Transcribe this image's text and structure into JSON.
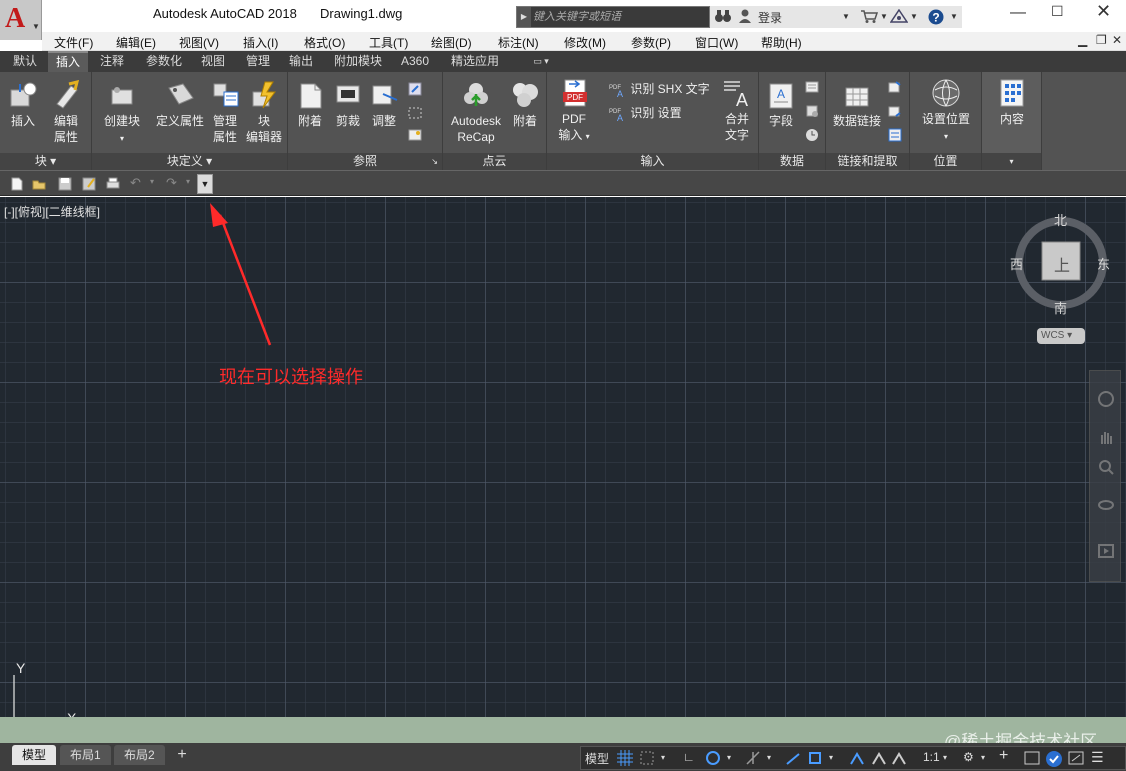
{
  "window": {
    "app_title": "Autodesk AutoCAD 2018",
    "document": "Drawing1.dwg",
    "search_placeholder": "键入关键字或短语",
    "login_label": "登录"
  },
  "menubar": {
    "items": [
      "文件(F)",
      "编辑(E)",
      "视图(V)",
      "插入(I)",
      "格式(O)",
      "工具(T)",
      "绘图(D)",
      "标注(N)",
      "修改(M)",
      "参数(P)",
      "窗口(W)",
      "帮助(H)"
    ]
  },
  "ribbon_tabs": {
    "items": [
      "默认",
      "插入",
      "注释",
      "参数化",
      "视图",
      "管理",
      "输出",
      "附加模块",
      "A360",
      "精选应用"
    ],
    "active": "插入"
  },
  "ribbon": {
    "block": {
      "title": "块",
      "insert": "插入",
      "edit_attr_1": "编辑",
      "edit_attr_2": "属性"
    },
    "block_def": {
      "title": "块定义",
      "create": "创建块",
      "define_attr": "定义属性",
      "manage_attr_1": "管理",
      "manage_attr_2": "属性",
      "block_editor_1": "块",
      "block_editor_2": "编辑器"
    },
    "reference": {
      "title": "参照",
      "attach": "附着",
      "clip": "剪裁",
      "adjust": "调整"
    },
    "pointcloud": {
      "title": "点云",
      "recap_1": "Autodesk",
      "recap_2": "ReCap",
      "attach": "附着"
    },
    "import": {
      "title": "输入",
      "pdf_1": "PDF",
      "pdf_2": "输入",
      "recognize_shx": "识别 SHX 文字",
      "recognize_settings": "识别 设置",
      "combine_1": "合并",
      "combine_2": "文字"
    },
    "data": {
      "title": "数据",
      "field": "字段"
    },
    "linking": {
      "title": "链接和提取",
      "data_link": "数据链接"
    },
    "location": {
      "title": "位置",
      "set_location": "设置位置"
    },
    "content": {
      "label": "内容"
    }
  },
  "canvas": {
    "viewport_label": "[-][俯视][二维线框]",
    "annotation": "现在可以选择操作",
    "annotation_color": "#ff2a2a",
    "viewcube": {
      "north": "北",
      "south": "南",
      "east": "东",
      "west": "西",
      "face": "上"
    },
    "wcs": "WCS",
    "ucs_x": "X",
    "ucs_y": "Y"
  },
  "watermark": "@稀土掘金技术社区",
  "statusbar": {
    "tabs": [
      "模型",
      "布局1",
      "布局2"
    ],
    "active_tab": "模型",
    "model_label": "模型",
    "scale": "1:1"
  }
}
